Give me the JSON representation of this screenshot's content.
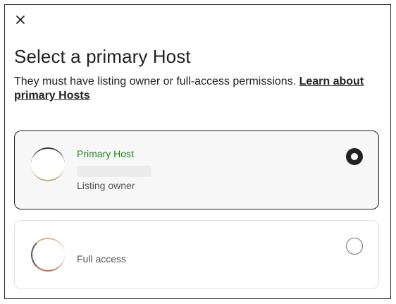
{
  "modal": {
    "title": "Select a primary Host",
    "subtitle": "They must have listing owner or full-access permissions. ",
    "learn_more_link": "Learn about primary Hosts",
    "close_icon": "close-icon"
  },
  "options": [
    {
      "tag": "Primary Host",
      "permission": "Listing owner",
      "selected": true
    },
    {
      "permission": "Full access",
      "selected": false
    }
  ],
  "colors": {
    "accent_green": "#1f8a1f",
    "text": "#222222",
    "muted": "#555555"
  }
}
